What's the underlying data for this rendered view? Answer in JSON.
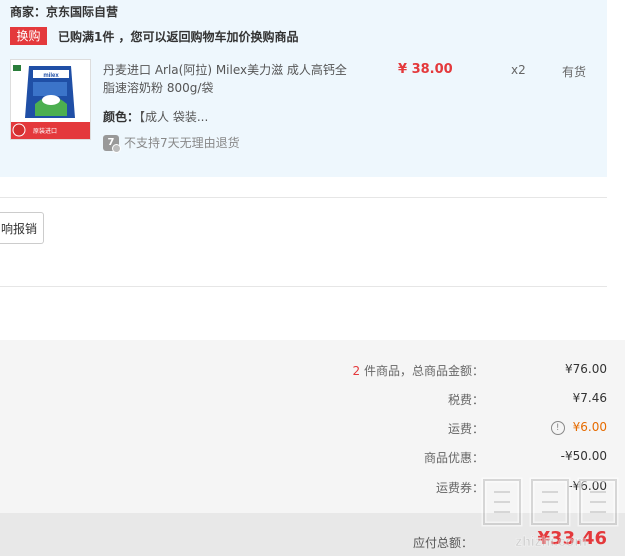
{
  "vendor": {
    "label": "商家：京东国际自营"
  },
  "promo": {
    "tag": "换购",
    "text": "已购满1件 ，您可以返回购物车加价换购商品"
  },
  "product": {
    "name": "丹麦进口 Arla(阿拉) Milex美力滋 成人高钙全脂速溶奶粉 800g/袋",
    "price": "¥ 38.00",
    "quantity": "x2",
    "stock": "有货",
    "color_label": "颜色：",
    "color_value": "【成人 袋装...",
    "return_icon_text": "7",
    "return_text": "不支持7天无理由退货",
    "thumb_banner": "原装进口"
  },
  "invoice_button": {
    "label": "响报销"
  },
  "summary": {
    "count": "2",
    "count_label": " 件商品，总商品金额：",
    "subtotal": "¥76.00",
    "tax_label": "税费：",
    "tax": "¥7.46",
    "shipping_label": "运费：",
    "shipping": "¥6.00",
    "discount_label": "商品优惠：",
    "discount": "-¥50.00",
    "coupon_label": "运费券：",
    "coupon": "-¥6.00",
    "total_label": "应付总额：",
    "total": "¥33.46"
  },
  "watermark": {
    "text": "zhizhi.com"
  },
  "colors": {
    "accent": "#e4393c",
    "shipping": "#e66b00",
    "panel": "#eef7fd"
  }
}
